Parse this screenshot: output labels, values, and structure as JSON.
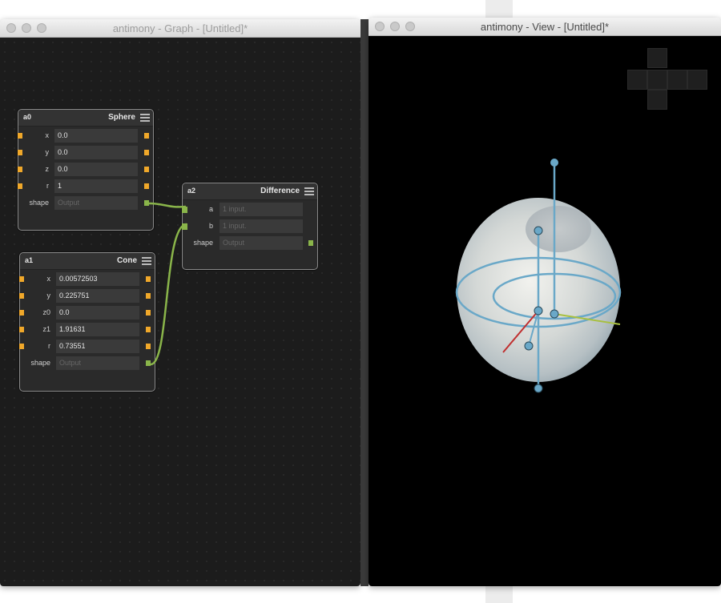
{
  "graph_window": {
    "title": "antimony - Graph - [Untitled]*",
    "nodes": {
      "sphere": {
        "id": "a0",
        "type": "Sphere",
        "rows": [
          {
            "label": "x",
            "value": "0.0"
          },
          {
            "label": "y",
            "value": "0.0"
          },
          {
            "label": "z",
            "value": "0.0"
          },
          {
            "label": "r",
            "value": "1"
          },
          {
            "label": "shape",
            "placeholder": "Output"
          }
        ]
      },
      "cone": {
        "id": "a1",
        "type": "Cone",
        "rows": [
          {
            "label": "x",
            "value": "0.00572503"
          },
          {
            "label": "y",
            "value": "0.225751"
          },
          {
            "label": "z0",
            "value": "0.0"
          },
          {
            "label": "z1",
            "value": "1.91631"
          },
          {
            "label": "r",
            "value": "0.73551"
          },
          {
            "label": "shape",
            "placeholder": "Output"
          }
        ]
      },
      "difference": {
        "id": "a2",
        "type": "Difference",
        "rows": [
          {
            "label": "a",
            "placeholder": "1 input."
          },
          {
            "label": "b",
            "placeholder": "1 input."
          },
          {
            "label": "shape",
            "placeholder": "Output"
          }
        ]
      }
    }
  },
  "view_window": {
    "title": "antimony - View - [Untitled]*"
  },
  "colors": {
    "float_port": "#f0a82a",
    "shape_port": "#8ab54a",
    "wire": "#8ab54a",
    "handle": "#6aa8c8",
    "x_axis": "#c03030",
    "y_axis": "#a8c040"
  },
  "icons": [
    "node-menu-icon",
    "window-close-light",
    "window-minimize-light",
    "window-zoom-light",
    "view-cube-icon"
  ]
}
